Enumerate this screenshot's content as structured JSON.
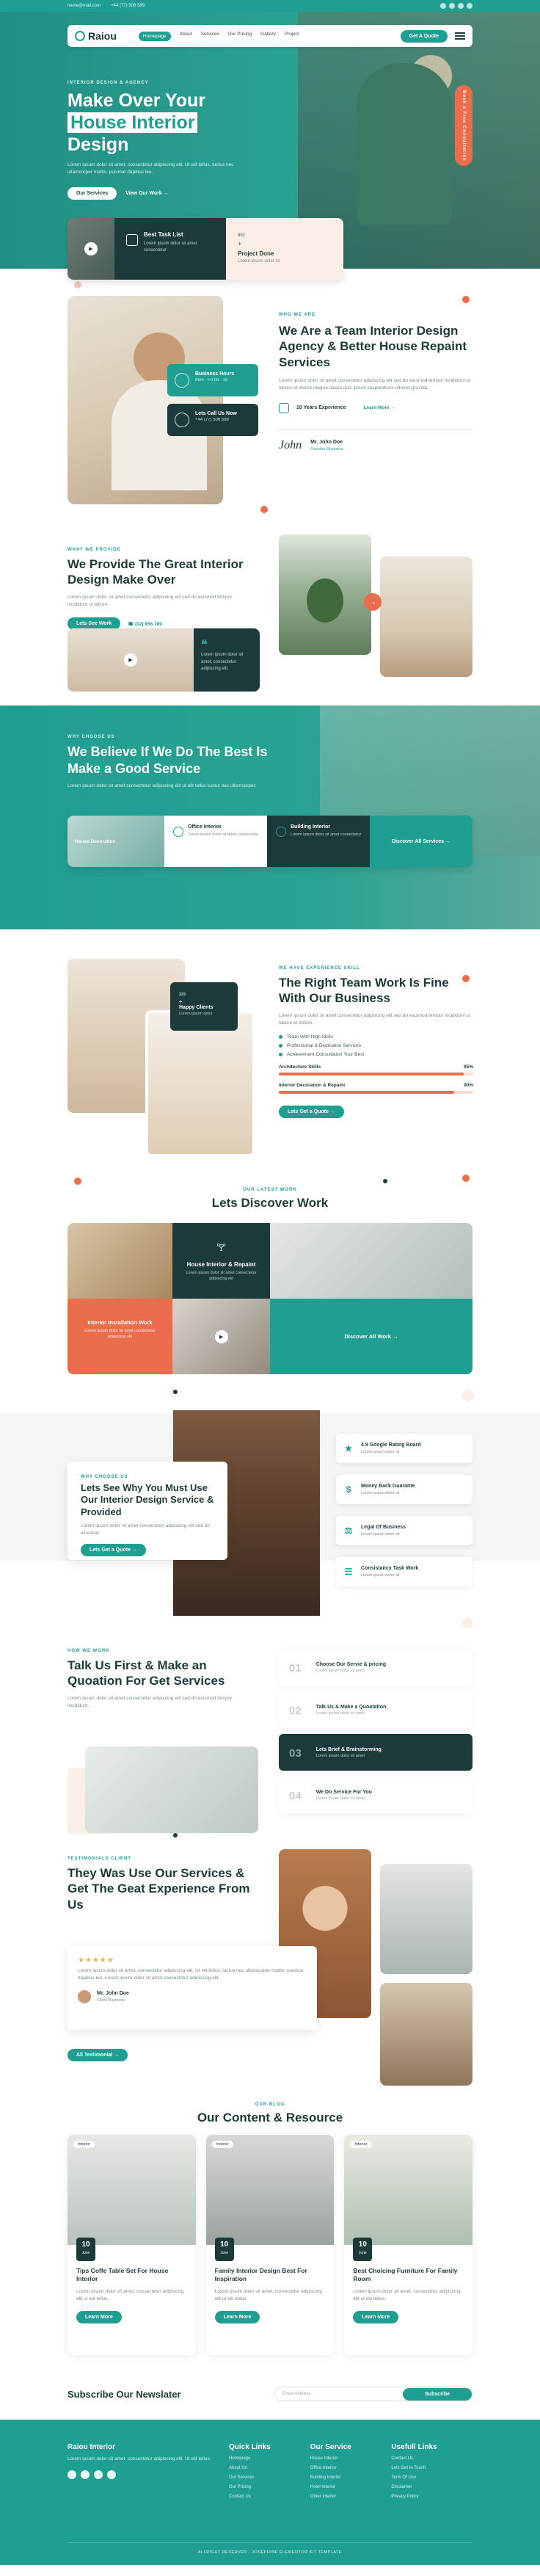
{
  "topbar": {
    "email": "name@mail.com",
    "phone": "+44 (77) 506 589"
  },
  "header": {
    "logo": "Raiou",
    "nav": [
      "Homepage",
      "About",
      "Services",
      "Our Pricing",
      "Gallery",
      "Project"
    ],
    "cta": "Get A Quote"
  },
  "hero": {
    "kicker": "Interior Design & Agency",
    "title_1": "Make Over Your",
    "title_hl": "House Interior",
    "title_2": "Design",
    "text": "Lorem ipsum dolor sit amet, consectetur adipiscing elit. Ut elit tellus, luctus nec ullamcorper mattis, pulvinar dapibus leo.",
    "btn_primary": "Our Services",
    "btn_link": "View Our Work →",
    "vertical_badge": "Book a Free Consultation",
    "task_title": "Best Task List",
    "task_text": "Lorem ipsum dolor sit amet consectetur",
    "count": "852",
    "count_suffix": "+",
    "count_title": "Project Done",
    "count_text": "Lorem ipsum dolor sit"
  },
  "about": {
    "kicker": "Who We Are",
    "title": "We Are a Team Interior Design Agency & Better House Repaint Services",
    "text": "Lorem ipsum dolor sit amet consectetur adipiscing elit sed do eiusmod tempor incididunt ut labore et dolore magna aliqua quis ipsum suspendisse ultrices gravida.",
    "experience": "10 Years Experience",
    "link": "Learn More →",
    "card1_title": "Business Hours",
    "card1_text": "Mon - Fri 08 - 16",
    "card2_title": "Lets Call Us Now",
    "card2_text": "+44 (77) 506 589",
    "signature": "John",
    "person_name": "Mr. John Doe",
    "person_role": "Founder Business"
  },
  "makeover": {
    "kicker": "What We Provide",
    "title": "We Provide The Great Interior Design Make Over",
    "text": "Lorem ipsum dolor sit amet consectetur adipiscing elit sed do eiusmod tempor incididunt ut labore.",
    "btn": "Lets See Work",
    "link": "☎ (02) 856 789",
    "quote": "Lorem ipsum dolor sit amet, consectetur adipiscing elit."
  },
  "believe": {
    "kicker": "Why Choose Us",
    "title": "We Believe If We Do The Best Is Make a Good Service",
    "text": "Lorem ipsum dolor sit amet consectetur adipiscing elit ut elit tellus luctus nec ullamcorper.",
    "img_label": "House Decoration",
    "card1_title": "Office Interior",
    "card1_text": "Lorem ipsum dolor sit amet consectetur",
    "card2_title": "Building Interior",
    "card2_text": "Lorem ipsum dolor sit amet consectetur",
    "all_services": "Discover All Services →"
  },
  "team": {
    "badge_num": "325",
    "badge_suffix": "+",
    "badge_title": "Happy Clients",
    "badge_text": "Lorem ipsum dolor",
    "kicker": "We Have Experience Skill",
    "title": "The Right Team Work Is Fine With Our Business",
    "text": "Lorem ipsum dolor sit amet consectetur adipiscing elit sed do eiusmod tempor incididunt ut labore et dolore.",
    "list": [
      "Team With High Skills",
      "Professional & Dedication Services",
      "Achievement Consultation Your Best"
    ],
    "bars": [
      {
        "label": "Architecture Skills",
        "value": 95,
        "text": "95%"
      },
      {
        "label": "Interior Decoration & Repaint",
        "value": 90,
        "text": "90%"
      }
    ],
    "btn": "Lets Get a Quote →"
  },
  "discover": {
    "kicker": "Our Latest Work",
    "title": "Lets Discover Work",
    "center_title": "House Interior & Repaint",
    "center_text": "Lorem ipsum dolor sit amet consectetur adipiscing elit",
    "orange_title": "Interior Installation Work",
    "orange_text": "Lorem ipsum dolor sit amet consectetur adipiscing elit",
    "all_work": "Discover All Work →"
  },
  "why": {
    "kicker": "Why Choose Us",
    "title": "Lets See Why You Must Use Our Interior Design Service & Provided",
    "text": "Lorem ipsum dolor sit amet consectetur adipiscing elit sed do eiusmod.",
    "btn": "Lets Get a Quote →",
    "items": [
      {
        "title": "4.9 Google Rating Board",
        "text": "Lorem ipsum dolor sit",
        "icon": "★"
      },
      {
        "title": "Money Back Guarante",
        "text": "Lorem ipsum dolor sit",
        "icon": "$"
      },
      {
        "title": "Legal Of Business",
        "text": "Lorem ipsum dolor sit",
        "icon": "⚖"
      },
      {
        "title": "Consistancy Task Work",
        "text": "Lorem ipsum dolor sit",
        "icon": "☰"
      }
    ]
  },
  "talk": {
    "kicker": "How We Work",
    "title": "Talk Us First & Make an Quoation For Get Services",
    "text": "Lorem ipsum dolor sit amet consectetur adipiscing elit sed do eiusmod tempor incididunt.",
    "steps": [
      {
        "num": "01",
        "title": "Choose Our Servie & pricing",
        "text": "Lorem ipsum dolor sit amet"
      },
      {
        "num": "02",
        "title": "Talk Us & Make a Quoatation",
        "text": "Lorem ipsum dolor sit amet"
      },
      {
        "num": "03",
        "title": "Lets Brief & Brainstorming",
        "text": "Lorem ipsum dolor sit amet"
      },
      {
        "num": "04",
        "title": "We Do Service For You",
        "text": "Lorem ipsum dolor sit amet"
      }
    ]
  },
  "testimonials": {
    "kicker": "Testimonials Client",
    "title": "They Was Use Our Services & Get The Geat Experience From Us",
    "stars": "★★★★★",
    "quote": "Lorem ipsum dolor sit amet, consectetur adipiscing elit. Ut elit tellus, luctus nec ullamcorper mattis, pulvinar dapibus leo. Lorem ipsum dolor sit amet consectetur adipiscing elit.",
    "person_name": "Mr. John Doe",
    "person_role": "Client Business",
    "btn": "All Testimonial →"
  },
  "blog": {
    "kicker": "Our Blog",
    "title": "Our Content & Resource",
    "posts": [
      {
        "tag": "Interior",
        "day": "10",
        "month": "June",
        "title": "Tips Coffe Table Set For House Interior",
        "text": "Lorem ipsum dolor sit amet, consectetur adipiscing elit ut elit tellus.",
        "btn": "Learn More"
      },
      {
        "tag": "Interior",
        "day": "10",
        "month": "June",
        "title": "Family Interior Design Best For Inspiration",
        "text": "Lorem ipsum dolor sit amet, consectetur adipiscing elit ut elit tellus.",
        "btn": "Learn More"
      },
      {
        "tag": "Interior",
        "day": "10",
        "month": "June",
        "title": "Best Choicing Furniture For Family Room",
        "text": "Lorem ipsum dolor sit amet, consectetur adipiscing elit ut elit tellus.",
        "btn": "Learn More"
      }
    ]
  },
  "newsletter": {
    "title": "Subscribe Our Newslater",
    "placeholder": "Email Address",
    "btn": "Subscribe"
  },
  "footer": {
    "brand": "Raiou Interior",
    "text": "Lorem ipsum dolor sit amet, consectetur adipiscing elit. Ut elit tellus.",
    "col1": {
      "title": "Quick Links",
      "items": [
        "Homepage",
        "About Us",
        "Our Services",
        "Our Pricing",
        "Contact Us"
      ]
    },
    "col2": {
      "title": "Our Service",
      "items": [
        "House Interior",
        "Office Interior",
        "Building Interior",
        "Hotel Interior",
        "Other Interior"
      ]
    },
    "col3": {
      "title": "Usefull Links",
      "items": [
        "Contact Us",
        "Lets Get In Touch",
        "Term Of Use",
        "Disclaimer",
        "Privacy Policy"
      ]
    },
    "copyright": "ALLRIGHT RESERVED - JOSEPHINE ELEMENTOR KIT TEMPLATE"
  },
  "colors": {
    "primary": "#1f9e92",
    "dark": "#1d3a3a",
    "accent": "#ea6e4e",
    "peach": "#fbeee6"
  }
}
